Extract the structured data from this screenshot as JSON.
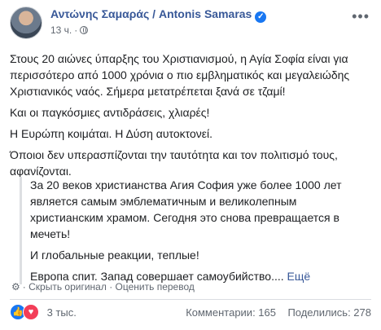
{
  "post": {
    "author": "Αντώνης Σαμαράς / Antonis Samaras",
    "time": "13 ч.",
    "paragraphs": [
      "Στους 20 αιώνες ύπαρξης του Χριστιανισμού, η Αγία Σοφία είναι για",
      "περισσότερο από 1000 χρόνια ο πιο εμβληματικός και μεγαλειώδης",
      "Χριστιανικός ναός. Σήμερα μετατρέπεται ξανά σε τζαμί!",
      "Και οι παγκόσμιες αντιδράσεις, χλιαρές!",
      "Η Ευρώπη κοιμάται. Η Δύση αυτοκτονεί.",
      "Όποιοι δεν υπερασπίζονται την ταυτότητα και τον πολιτισμό τους,",
      "αφανίζονται."
    ]
  },
  "translation": {
    "lines": [
      "За 20 веков христианства Агия София уже более 1000 лет",
      "является самым эмблематичным и великолепным",
      "христианским храмом. Сегодня это снова превращается в",
      "мечеть!",
      "И глобальные реакции, теплые!",
      "Европа спит. Запад совершает самоубийство...."
    ],
    "more_link": "Ещё",
    "hide_original": "Скрыть оригинал",
    "rate_translation": "Оценить перевод",
    "separator": "·"
  },
  "footer": {
    "reactions_count": "3 тыс.",
    "comments": "Комментарии: 165",
    "shares": "Поделились: 278"
  },
  "icons": {
    "options": "more-options-icon",
    "verified": "verified-badge-icon",
    "audience": "globe-icon",
    "like": "like-reaction-icon",
    "love": "love-reaction-icon",
    "settings": "gear-icon"
  },
  "colors": {
    "link": "#385898",
    "like": "#1877f2",
    "love": "#f33e58"
  }
}
